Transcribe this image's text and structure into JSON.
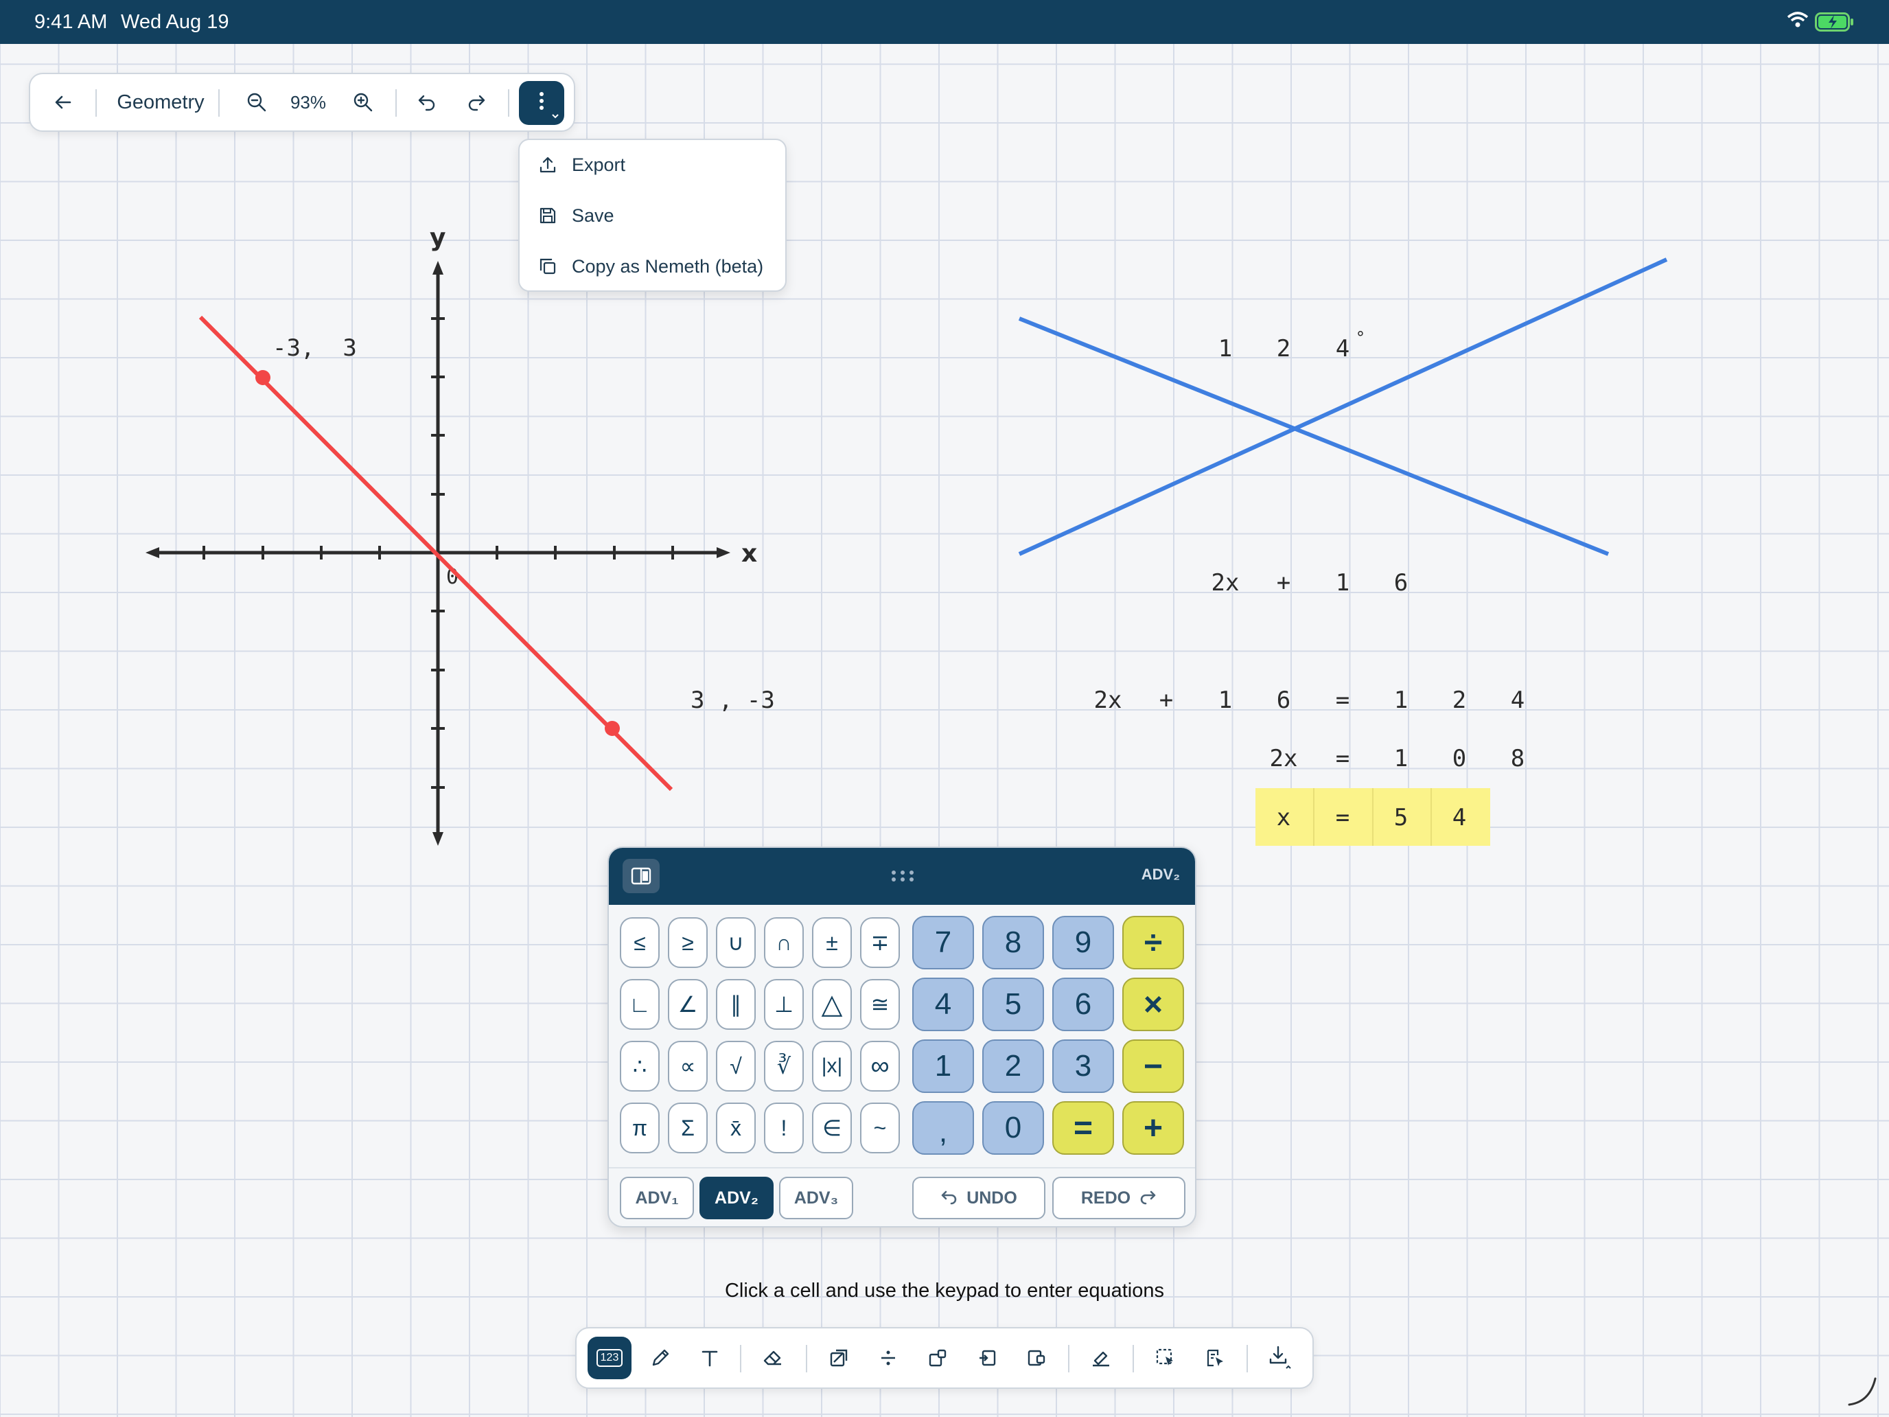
{
  "status_bar": {
    "time": "9:41 AM",
    "date": "Wed Aug 19",
    "icons": [
      "wifi-icon",
      "battery-charging-icon"
    ]
  },
  "toolbar": {
    "back_icon": "arrow-left-icon",
    "title": "Geometry",
    "zoom_level": "93%",
    "more_icon": "more-vertical-icon"
  },
  "menu": {
    "items": [
      {
        "label": "Export",
        "icon": "upload-icon"
      },
      {
        "label": "Save",
        "icon": "floppy-disk-icon"
      },
      {
        "label": "Copy as Nemeth (beta)",
        "icon": "copy-icon"
      }
    ]
  },
  "graph": {
    "x_label": "x",
    "y_label": "y",
    "origin_label": "0",
    "point_a_label": "-3,  3",
    "point_b_label": "3 , -3",
    "line_color": "#f24646",
    "axis_color": "#2b2b2b"
  },
  "angle_figure": {
    "line_color": "#3f7fe0",
    "label_cells": [
      "1",
      "2",
      "4"
    ],
    "degree_mark": "°"
  },
  "expression_cells": [
    "2x",
    "+",
    "1",
    "6"
  ],
  "equation_rows": [
    [
      "2x",
      "+",
      "1",
      "6",
      "=",
      "1",
      "2",
      "4"
    ],
    [
      "2x",
      "=",
      "1",
      "0",
      "8"
    ],
    [
      "x",
      "=",
      "5",
      "4"
    ]
  ],
  "highlight_color": "#fbf38a",
  "keypad": {
    "mode_label": "ADV₂",
    "symbol_keys": [
      [
        "≤",
        "≥",
        "∪",
        "∩",
        "±",
        "∓"
      ],
      [
        "∟",
        "∠",
        "∥",
        "⊥",
        "△",
        "≅"
      ],
      [
        "∴",
        "∝",
        "√",
        "∛",
        "|x|",
        "∞"
      ],
      [
        "π",
        "Σ",
        "x̄",
        "!",
        "∈",
        "~"
      ]
    ],
    "number_keys": [
      [
        "7",
        "8",
        "9"
      ],
      [
        "4",
        "5",
        "6"
      ],
      [
        "1",
        "2",
        "3"
      ],
      [
        ",",
        "0"
      ]
    ],
    "operator_keys": [
      "÷",
      "×",
      "−",
      "=",
      "+"
    ],
    "tabs": [
      "ADV₁",
      "ADV₂",
      "ADV₃"
    ],
    "active_tab": "ADV₂",
    "undo_label": "UNDO",
    "redo_label": "REDO"
  },
  "hint_text": "Click a cell and use the keypad to enter equations",
  "bottom_toolbar": {
    "keypad_badge": "123",
    "tools": [
      "keypad-icon",
      "pencil-icon",
      "text-icon",
      "eraser-icon",
      "shape-icon",
      "divide-icon",
      "insert-above-icon",
      "insert-left-icon",
      "insert-right-icon",
      "highlighter-icon",
      "lasso-select-icon",
      "export-pointer-icon",
      "download-icon"
    ]
  }
}
